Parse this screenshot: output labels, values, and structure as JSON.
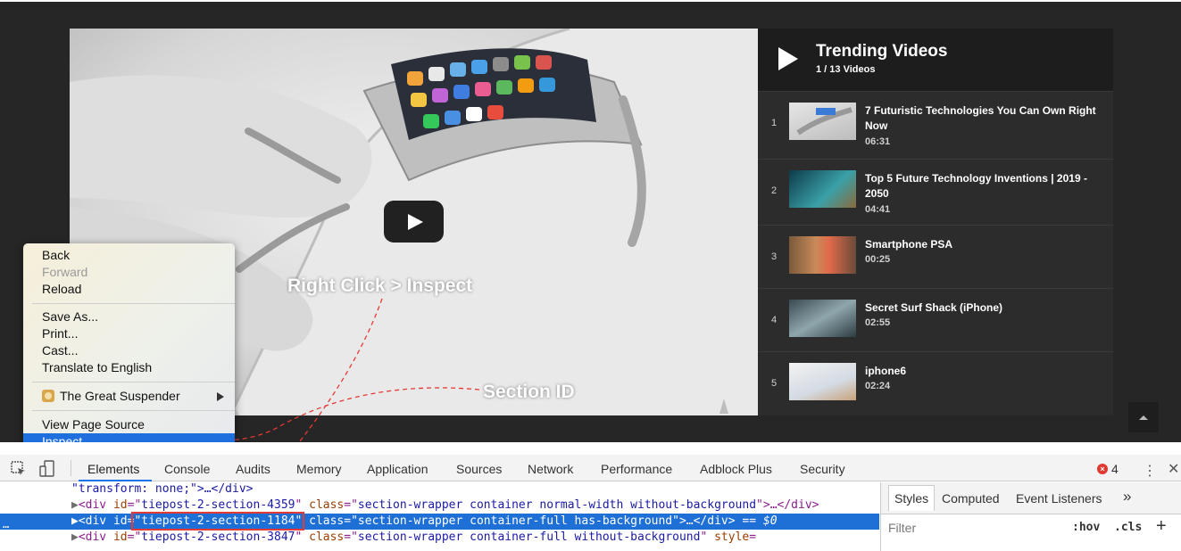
{
  "annotations": {
    "right_click": "Right Click > Inspect",
    "section_id": "Section ID"
  },
  "playlist": {
    "title": "Trending Videos",
    "count": "1 / 13 Videos",
    "items": [
      {
        "num": "1",
        "title": "7 Futuristic Technologies You Can Own Right Now",
        "duration": "06:31"
      },
      {
        "num": "2",
        "title": "Top 5 Future Technology Inventions | 2019 - 2050",
        "duration": "04:41"
      },
      {
        "num": "3",
        "title": "Smartphone PSA",
        "duration": "00:25"
      },
      {
        "num": "4",
        "title": "Secret Surf Shack (iPhone)",
        "duration": "02:55"
      },
      {
        "num": "5",
        "title": "iphone6",
        "duration": "02:24"
      }
    ]
  },
  "context_menu": {
    "back": "Back",
    "forward": "Forward",
    "reload": "Reload",
    "save_as": "Save As...",
    "print": "Print...",
    "cast": "Cast...",
    "translate": "Translate to English",
    "extension": "The Great Suspender",
    "view_source": "View Page Source",
    "inspect": "Inspect"
  },
  "devtools": {
    "tabs": [
      "Elements",
      "Console",
      "Audits",
      "Memory",
      "Application",
      "Sources",
      "Network",
      "Performance",
      "Adblock Plus",
      "Security"
    ],
    "active_tab": "Elements",
    "error_count": "4",
    "code": {
      "line0": "\"transform: none;\">…</div>",
      "line1_id": "tiepost-2-section-4359",
      "line1_class": "section-wrapper container normal-width without-background",
      "line2_id": "tiepost-2-section-1184",
      "line2_class": "section-wrapper container-full has-background",
      "line2_suffix": "$0",
      "line3_id": "tiepost-2-section-3847",
      "line3_class": "section-wrapper container-full without-background"
    },
    "styles_tabs": [
      "Styles",
      "Computed",
      "Event Listeners"
    ],
    "filter_placeholder": "Filter",
    "hov": ":hov",
    "cls": ".cls"
  },
  "colors": {
    "page_bg": "#262626",
    "selection_blue": "#1e6fd6",
    "annotation_red": "#e53935"
  }
}
